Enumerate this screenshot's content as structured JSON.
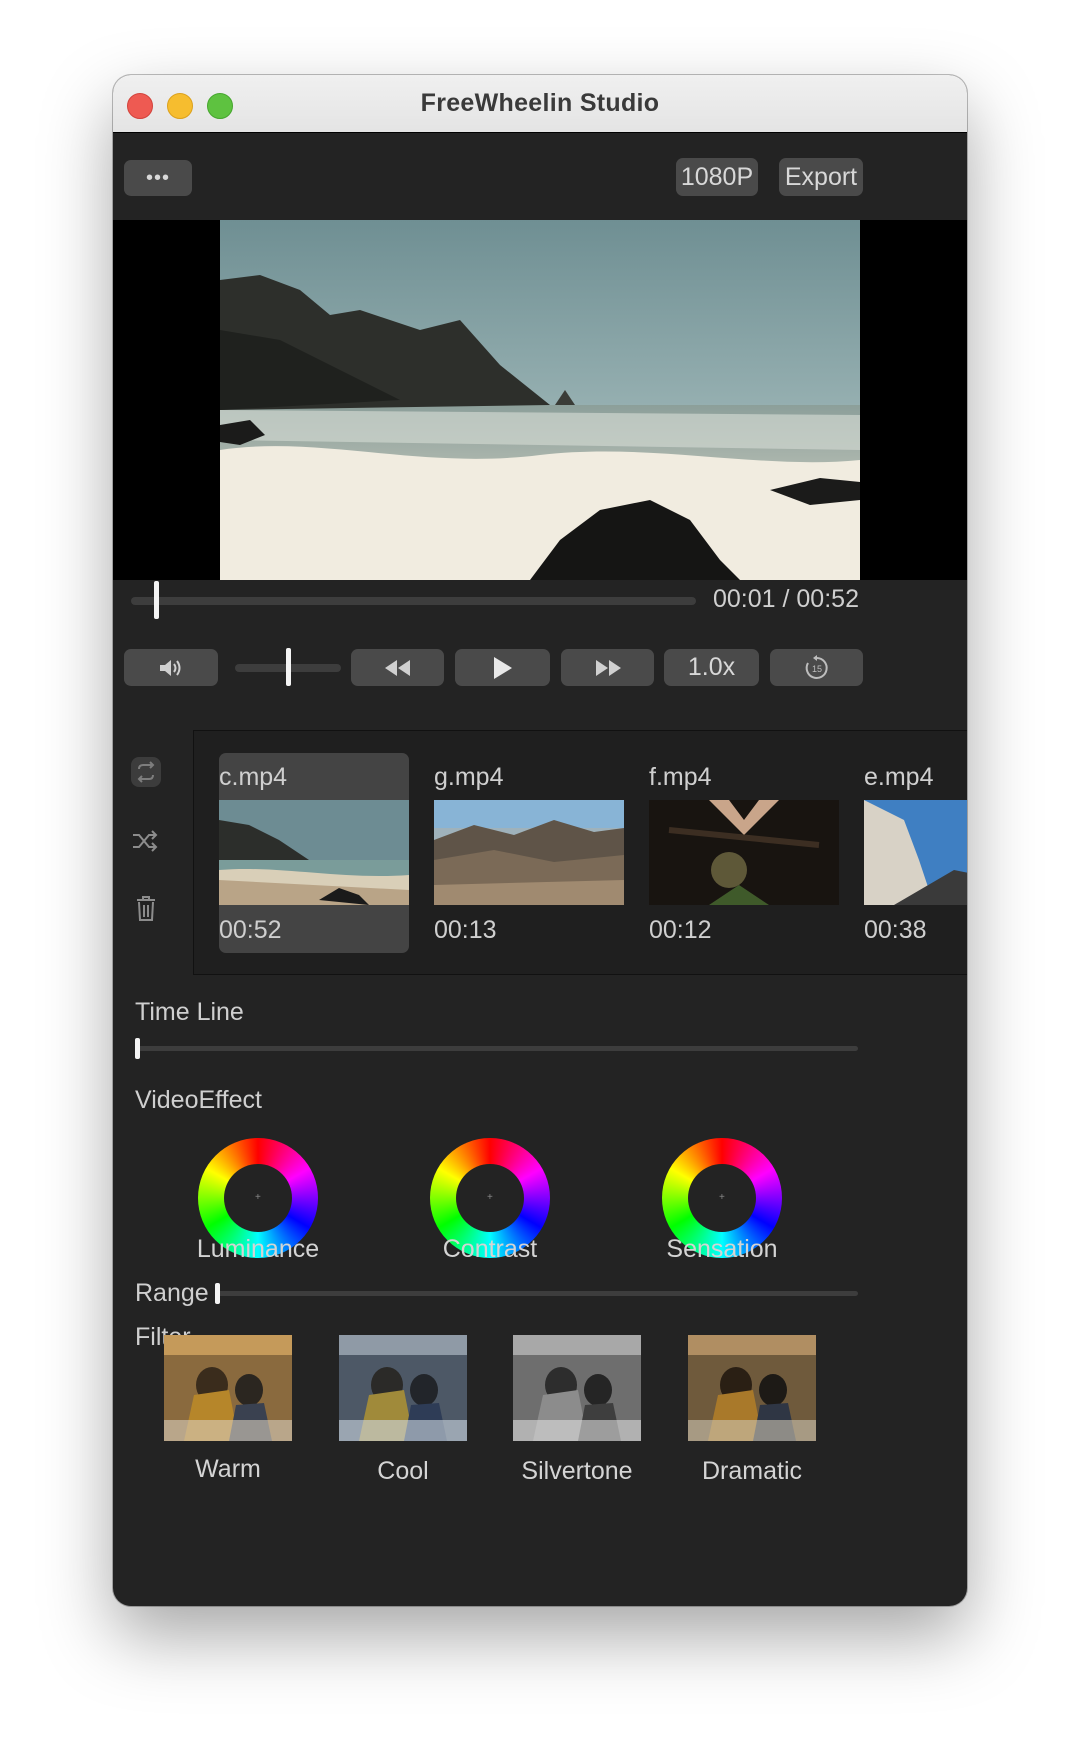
{
  "window": {
    "title": "FreeWheelin Studio"
  },
  "toolbar": {
    "more_label": "•••",
    "resolution_label": "1080P",
    "export_label": "Export"
  },
  "player": {
    "current_time": "00:01",
    "separator": " / ",
    "total_time": "00:52",
    "progress_fraction": 0.02
  },
  "controls": {
    "speed_label": "1.0x",
    "volume_fraction": 0.5,
    "replay_seconds": "15"
  },
  "sidebar_icons": [
    "loop-icon",
    "shuffle-icon",
    "trash-icon"
  ],
  "clips": [
    {
      "name": "c.mp4",
      "duration": "00:52",
      "selected": true
    },
    {
      "name": "g.mp4",
      "duration": "00:13",
      "selected": false
    },
    {
      "name": "f.mp4",
      "duration": "00:12",
      "selected": false
    },
    {
      "name": "e.mp4",
      "duration": "00:38",
      "selected": false
    }
  ],
  "timeline": {
    "label": "Time Line",
    "value_fraction": 0.0
  },
  "video_effect": {
    "label": "VideoEffect",
    "wheels": [
      {
        "label": "Luminance"
      },
      {
        "label": "Contrast"
      },
      {
        "label": "Sensation"
      }
    ]
  },
  "range": {
    "label": "Range",
    "value_fraction": 0.0
  },
  "filter": {
    "label": "Filter",
    "items": [
      {
        "label": "Warm"
      },
      {
        "label": "Cool"
      },
      {
        "label": "Silvertone"
      },
      {
        "label": "Dramatic"
      }
    ]
  }
}
